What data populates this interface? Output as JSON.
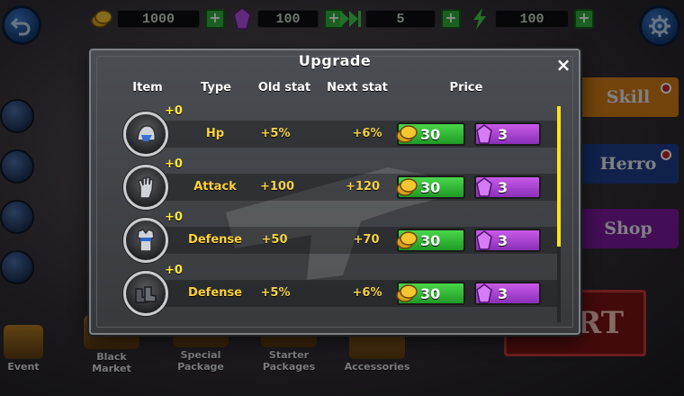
{
  "resources": [
    {
      "icon": "gold-coin-icon",
      "value": "1000"
    },
    {
      "icon": "purple-gem-icon",
      "value": "100"
    },
    {
      "icon": "fast-forward-icon",
      "value": "5"
    },
    {
      "icon": "lightning-icon",
      "value": "100"
    }
  ],
  "right_menu": {
    "skill": "Skill",
    "hero": "Herro",
    "shop": "Shop"
  },
  "start": {
    "label": "ART"
  },
  "bottom_bar": {
    "event": "Event",
    "black_market": "Black Market",
    "special_package": "Special Package",
    "starter_packages": "Starter Packages",
    "accessories": "Accessories"
  },
  "modal": {
    "title": "Upgrade",
    "close_label": "×",
    "headers": {
      "item": "Item",
      "type": "Type",
      "old_stat": "Old stat",
      "next_stat": "Next stat",
      "price": "Price"
    },
    "rows": [
      {
        "item_icon": "helmet-icon",
        "level": "+0",
        "type": "Hp",
        "old_stat": "+5%",
        "next_stat": "+6%",
        "gold_price": "30",
        "gem_price": "3"
      },
      {
        "item_icon": "gauntlet-icon",
        "level": "+0",
        "type": "Attack",
        "old_stat": "+100",
        "next_stat": "+120",
        "gold_price": "30",
        "gem_price": "3"
      },
      {
        "item_icon": "armor-icon",
        "level": "+0",
        "type": "Defense",
        "old_stat": "+50",
        "next_stat": "+70",
        "gold_price": "30",
        "gem_price": "3"
      },
      {
        "item_icon": "boots-icon",
        "level": "+0",
        "type": "Defense",
        "old_stat": "+5%",
        "next_stat": "+6%",
        "gold_price": "30",
        "gem_price": "3"
      }
    ]
  },
  "colors": {
    "accent_yellow": "#ffd23a",
    "gold_button": "#2fb835",
    "gem_button": "#a942d6",
    "scroll_thumb": "#ffe21a"
  }
}
